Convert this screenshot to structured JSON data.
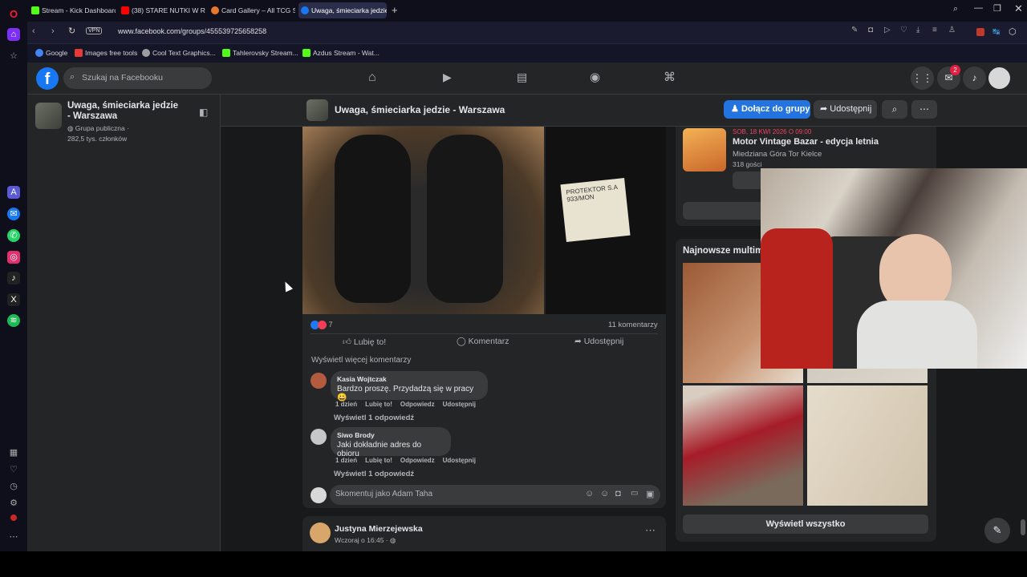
{
  "browser": {
    "tabs": [
      {
        "label": "Stream - Kick Dashboard",
        "color": "#53fc18"
      },
      {
        "label": "(38) STARE NUTKI W R",
        "color": "#ff0000"
      },
      {
        "label": "Card Gallery – All TCG Se",
        "color": "#e8772e"
      },
      {
        "label": "Uwaga, śmieciarka jedzie",
        "color": "#1877f2"
      }
    ],
    "url": "www.facebook.com/groups/455539725658258",
    "vpn": "VPN",
    "bookmarks": [
      {
        "label": "Google",
        "color": "#4285f4"
      },
      {
        "label": "Images free tools",
        "color": "#e53935"
      },
      {
        "label": "Cool Text Graphics...",
        "color": "#9e9e9e"
      },
      {
        "label": "Tahlerovsky Stream...",
        "color": "#53fc18"
      },
      {
        "label": "Azdus Stream - Wat...",
        "color": "#53fc18"
      }
    ]
  },
  "facebook": {
    "search_placeholder": "Szukaj na Facebooku",
    "notif_count": "2",
    "group": {
      "name": "Uwaga, śmieciarka jedzie - Warszawa",
      "type": "Grupa publiczna ·",
      "members": "282,5 tys. członków",
      "header_title": "Uwaga, śmieciarka jedzie - Warszawa",
      "join_label": "Dołącz do grupy",
      "share_label": "Udostępnij"
    },
    "post": {
      "label_text": "PROTEKTOR S.A\n933/MON",
      "reactions_count": "7",
      "comments_count": "11 komentarzy",
      "like_label": "Lubię to!",
      "comment_label": "Komentarz",
      "share_label": "Udostępnij",
      "more_comments": "Wyświetl więcej komentarzy",
      "comments": [
        {
          "name": "Kasia Wojtczak",
          "text": "Bardzo proszę. Przydadzą się w pracy 😀",
          "time": "1 dzień",
          "like": "Lubię to!",
          "reply": "Odpowiedz",
          "share": "Udostępnij",
          "replies": "Wyświetl 1 odpowiedź"
        },
        {
          "name": "Siwo Brody",
          "text": "Jaki dokładnie adres do obioru",
          "time": "1 dzień",
          "like": "Lubię to!",
          "reply": "Odpowiedz",
          "share": "Udostępnij",
          "replies": "Wyświetl 1 odpowiedź"
        }
      ],
      "comment_placeholder": "Skomentuj jako Adam Taha"
    },
    "next_post": {
      "author": "Justyna Mierzejewska",
      "time": "Wczoraj o 16:45 ·"
    },
    "event": {
      "date": "SOB, 18 KWI 2026 O 09:00",
      "title": "Motor Vintage Bazar - edycja letnia",
      "place": "Miedziana Góra Tor Kielce",
      "guests": "318 gości"
    },
    "media": {
      "title": "Najnowsze multimedia",
      "see_all": "Wyświetl wszystko"
    }
  }
}
